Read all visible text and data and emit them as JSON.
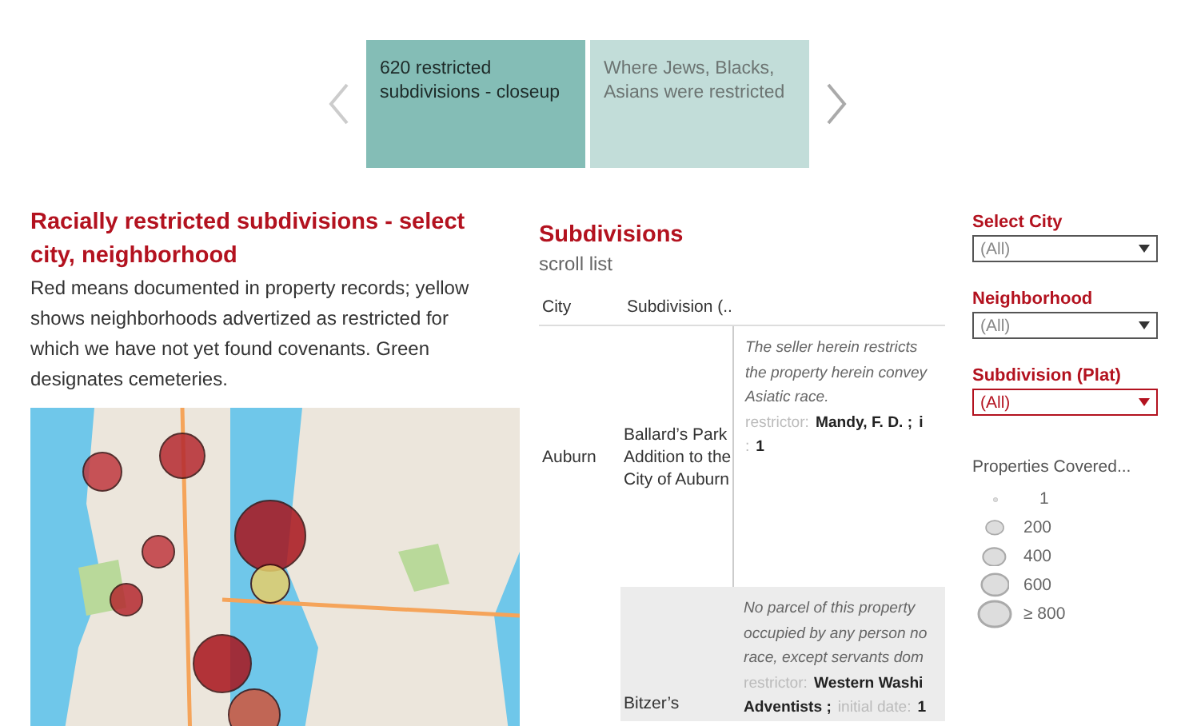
{
  "story_points": [
    {
      "label": "620 restricted subdivisions - closeup",
      "selected": true
    },
    {
      "label": "Where Jews, Blacks, Asians were restricted",
      "selected": false
    }
  ],
  "map_panel": {
    "title": "Racially restricted subdivisions - select city, neighborhood",
    "description": "Red means documented in property records; yellow shows neighborhoods advertized as restricted for which we have not yet found covenants. Green designates cemeteries."
  },
  "subdivisions": {
    "title": "Subdivisions",
    "subtitle": "scroll list",
    "columns": [
      "City",
      "Subdivision (.."
    ],
    "rows": [
      {
        "city": "Auburn",
        "subdivision": "Ballard’s Park Addition to the City of Auburn",
        "shaded": false,
        "covenant_lines": [
          "The seller herein restricts",
          "the property herein convey",
          "Asiatic race."
        ],
        "meta_lines": [
          [
            {
              "label": "restrictor:",
              "value": "Mandy, F. D. ;"
            },
            {
              "value": "i"
            }
          ],
          [
            {
              "label": ":",
              "value": "1"
            }
          ]
        ]
      },
      {
        "subdivision": "Bitzer’s",
        "shaded": true,
        "covenant_lines": [
          "No parcel of this property",
          "occupied by any person no",
          "race, except servants dom"
        ],
        "meta_lines": [
          [
            {
              "label": "restrictor:",
              "value": "Western Washi"
            }
          ],
          [
            {
              "value": "Adventists ;"
            },
            {
              "label": "initial date:",
              "value": "1"
            }
          ]
        ]
      }
    ]
  },
  "filters": [
    {
      "label": "Select City",
      "value": "(All)",
      "highlighted": false
    },
    {
      "label": "Neighborhood",
      "value": "(All)",
      "highlighted": false
    },
    {
      "label": "Subdivision (Plat)",
      "value": "(All)",
      "highlighted": true
    }
  ],
  "legend": {
    "title": "Properties Covered...",
    "items": [
      {
        "label": "1"
      },
      {
        "label": "200"
      },
      {
        "label": "400"
      },
      {
        "label": "600"
      },
      {
        "label": "≥ 800"
      }
    ]
  }
}
